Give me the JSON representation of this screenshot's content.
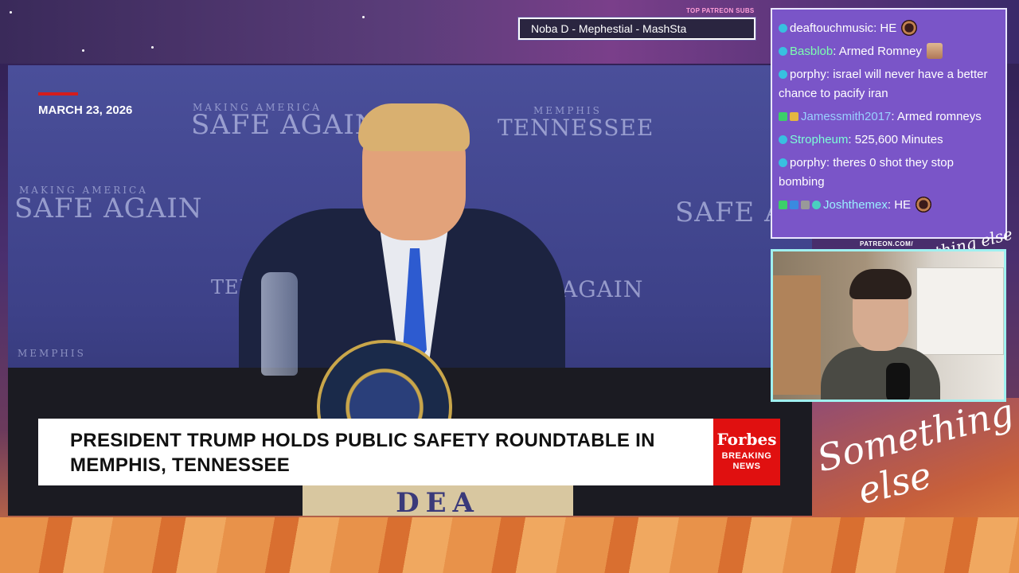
{
  "overlay": {
    "top_subs_label": "TOP PATREON SUBS",
    "top_subs_names": "Noba D - Mephestial - MashSta",
    "patreon_url": "PATREON.COM/",
    "brand_small": "Anything else",
    "brand_large_1": "Something",
    "brand_large_2": "else"
  },
  "video": {
    "date": "MARCH 23, 2026",
    "headline": "PRESIDENT TRUMP HOLDS PUBLIC SAFETY ROUNDTABLE IN\nMEMPHIS, TENNESSEE",
    "forbes_logo": "Forbes",
    "forbes_sub_1": "BREAKING",
    "forbes_sub_2": "NEWS",
    "backdrop": {
      "safe_again_small": "MAKING AMERICA",
      "safe_again": "SAFE AGAIN",
      "memphis": "MEMPHIS",
      "tennessee": "TENNESSEE",
      "again": "AGAIN",
      "safe_ag": "SAFE AG",
      "dea": "DEA"
    }
  },
  "chat": {
    "messages": [
      {
        "user": "deaftouchmusic",
        "text": ": HE ",
        "user_color": "#ffffff",
        "badges": [
          "circle"
        ],
        "emote": "round"
      },
      {
        "user": "Basblob",
        "text": ": Armed Romney ",
        "user_color": "#7dffb0",
        "badges": [
          "circle"
        ],
        "emote": "face"
      },
      {
        "user": "porphy",
        "text": ": israel will never have a better chance to pacify iran",
        "user_color": "#ffffff",
        "badges": [
          "circle"
        ]
      },
      {
        "user": "Jamessmith2017",
        "text": ": Armed romneys",
        "user_color": "#9ad0ff",
        "badges": [
          "green",
          "gold"
        ]
      },
      {
        "user": "Stropheum",
        "text": ": 525,600 Minutes",
        "user_color": "#7dffd8",
        "badges": [
          "circle"
        ]
      },
      {
        "user": "porphy",
        "text": ": theres 0 shot they stop bombing",
        "user_color": "#ffffff",
        "badges": [
          "circle"
        ]
      },
      {
        "user": "Joshthemex",
        "text": ": HE ",
        "user_color": "#9af0ff",
        "badges": [
          "green",
          "blue",
          "gray",
          "teal"
        ],
        "emote": "round"
      }
    ]
  },
  "colors": {
    "chat_bg": "#7a55c8",
    "forbes_red": "#e01010",
    "date_accent": "#d41c1c",
    "webcam_border": "#9ff0f0"
  }
}
